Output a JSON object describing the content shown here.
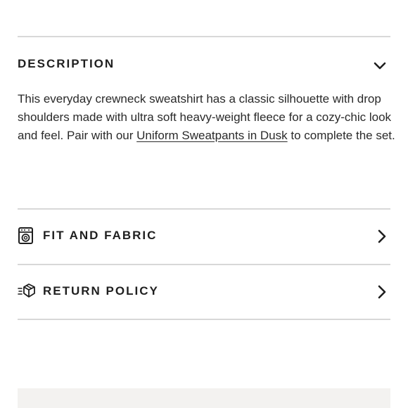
{
  "description_section": {
    "title": "DESCRIPTION",
    "expanded_icon": "chevron-down-icon",
    "text_before_link": "This everyday crewneck sweatshirt has a classic silhouette with drop shoulders made with ultra soft heavy-weight fleece for a cozy-chic look and feel. Pair with our ",
    "link_text": "Uniform Sweatpants in Dusk",
    "text_after_link": " to complete the set."
  },
  "accordion": [
    {
      "label": "FIT AND FABRIC",
      "icon": "washing-machine-icon",
      "chevron": "chevron-right-icon"
    },
    {
      "label": "RETURN POLICY",
      "icon": "moving-box-icon",
      "chevron": "chevron-right-icon"
    }
  ],
  "colors": {
    "text": "#1f1f1f",
    "divider": "#d8d8d8",
    "bottom_panel": "#f3f2f0"
  }
}
